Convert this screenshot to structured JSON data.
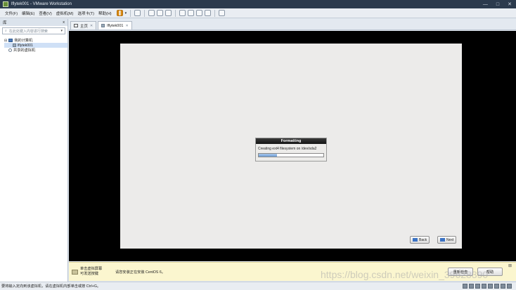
{
  "window": {
    "title": "lflytek001 - VMware Workstation"
  },
  "menu": [
    "文件(F)",
    "编辑(E)",
    "查看(V)",
    "虚拟机(M)",
    "选项卡(T)",
    "帮助(H)"
  ],
  "library": {
    "header": "库",
    "close": "x",
    "search_placeholder": "在此处键入内容进行搜索",
    "tree": {
      "root": "我的计算机",
      "vm": "lflytek001",
      "shared": "共享的虚拟机"
    }
  },
  "tabs": [
    {
      "label": "主页"
    },
    {
      "label": "lflytek001"
    }
  ],
  "installer": {
    "dialog_title": "Formatting",
    "dialog_message": "Creating ext4 filesystem on /dev/sda2",
    "progress": 0.28,
    "back_label": "Back",
    "next_label": "Next"
  },
  "hint_bar": {
    "line1": "单击虚拟屏幕",
    "line2": "可发送按键",
    "message": "请您安装正在安装 CentOS 6。",
    "btn_done": "重新检查",
    "btn_help": "帮助"
  },
  "status_text": "要将输入定向到该虚拟机，请在虚拟机内部单击或按 Ctrl+G。",
  "watermark": "https://blog.csdn.net/weixin_39628390"
}
